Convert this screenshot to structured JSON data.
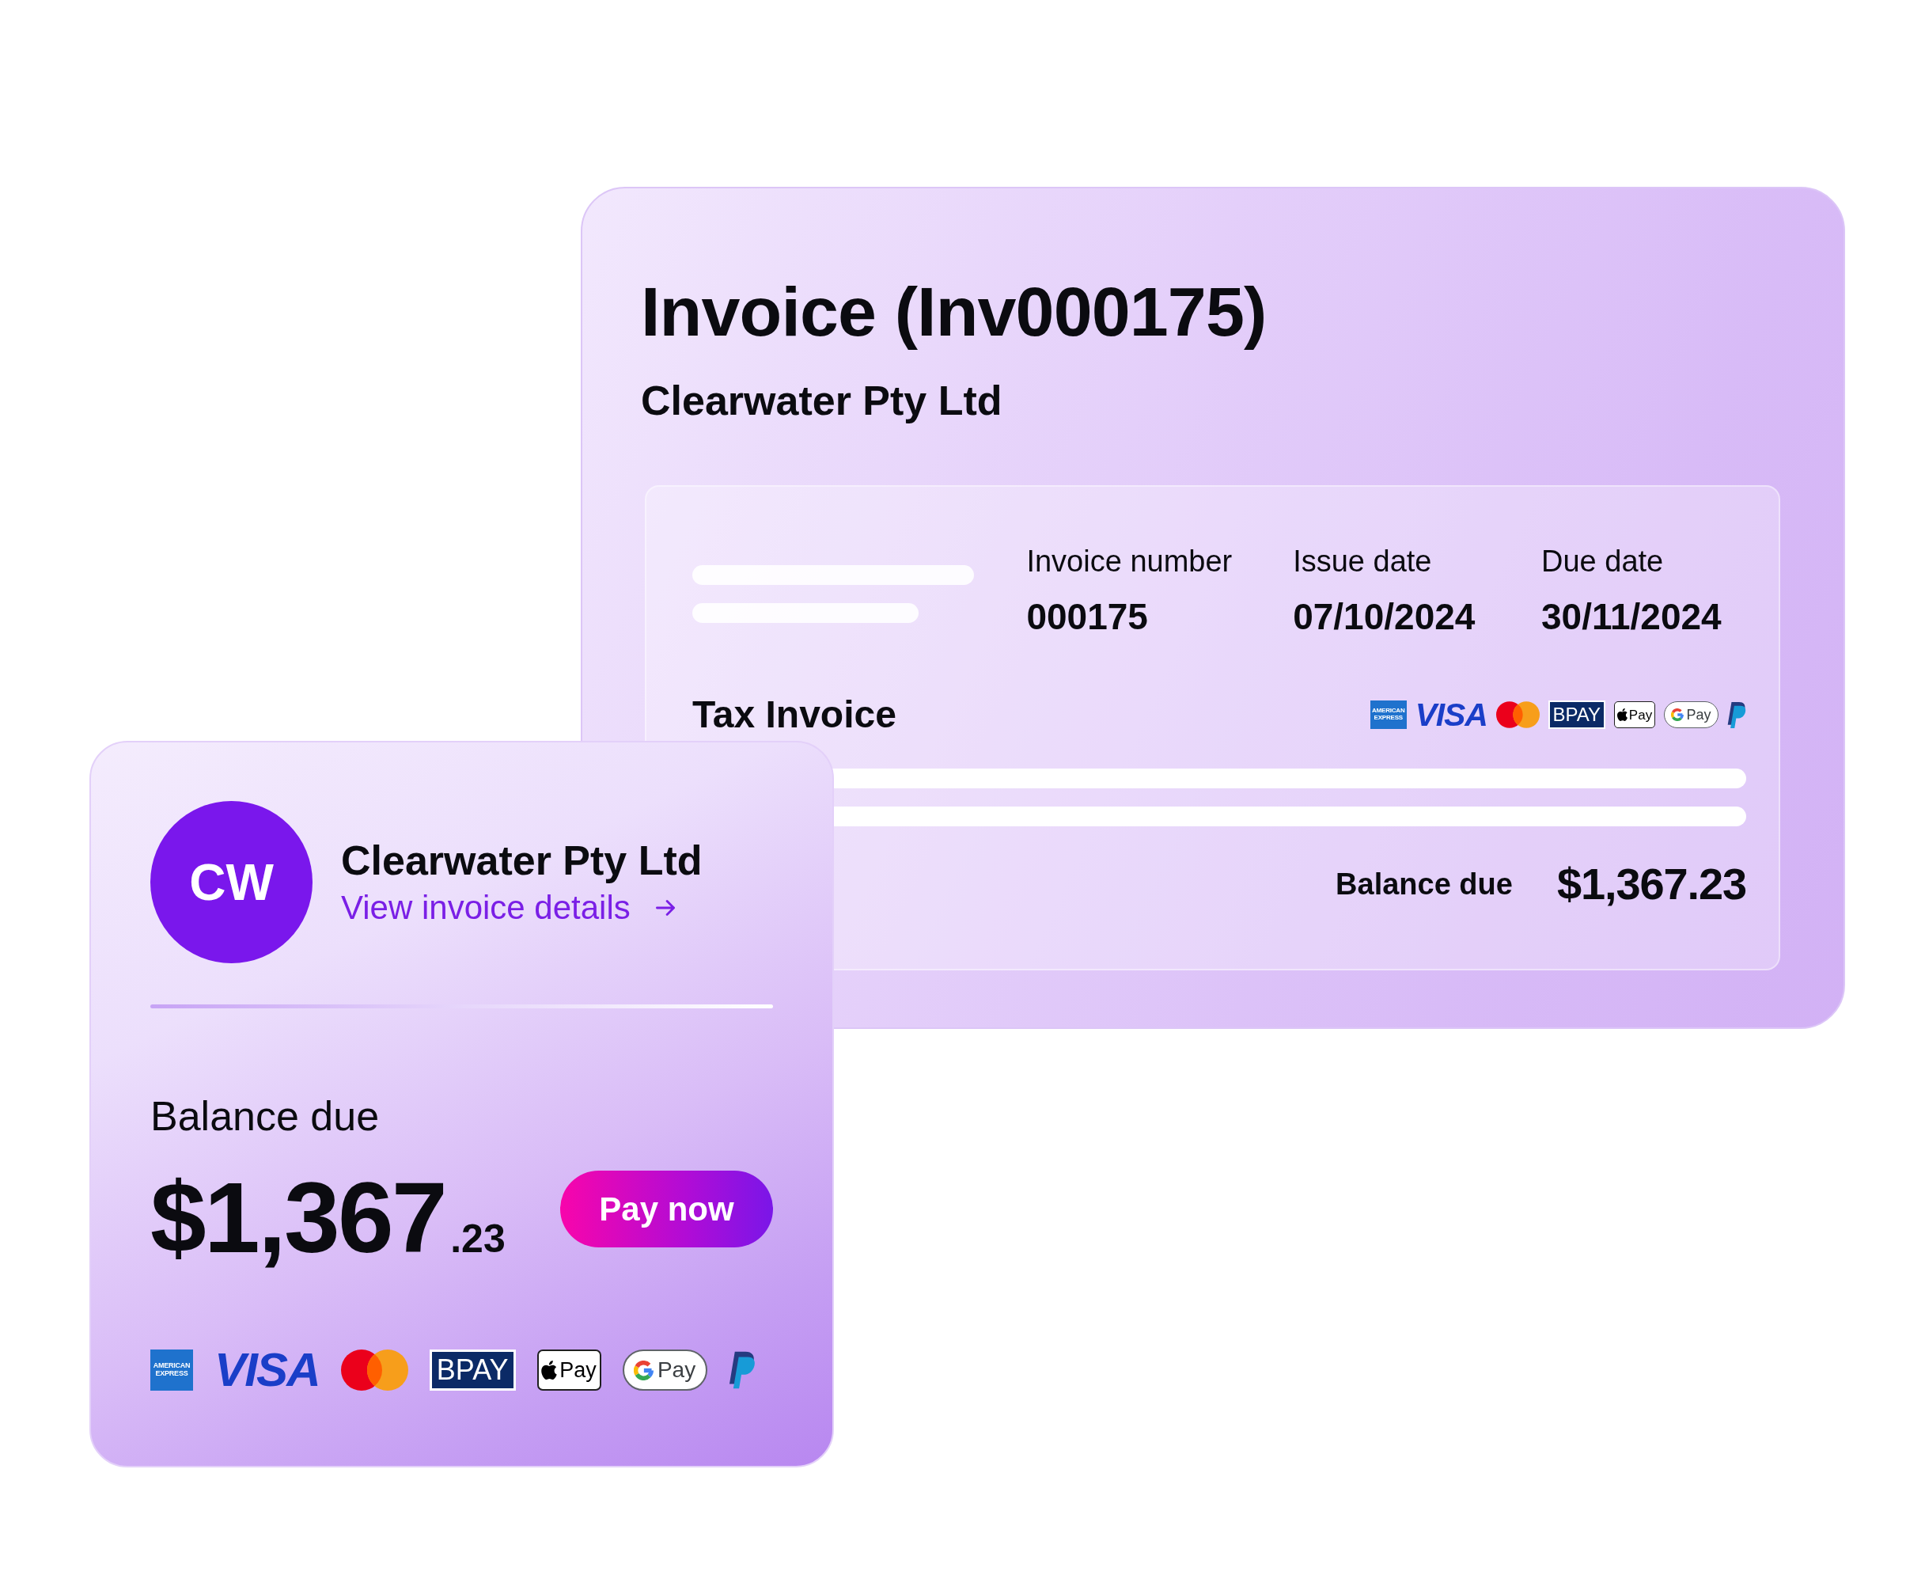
{
  "invoice_card": {
    "title": "Invoice (Inv000175)",
    "company": "Clearwater Pty Ltd",
    "details": {
      "fields": [
        {
          "label": "Invoice number",
          "value": "000175"
        },
        {
          "label": "Issue date",
          "value": "07/10/2024"
        },
        {
          "label": "Due date",
          "value": "30/11/2024"
        }
      ],
      "heading": "Tax Invoice",
      "payment_methods": [
        {
          "kind": "amex",
          "label": "AMERICAN EXPRESS"
        },
        {
          "kind": "visa",
          "label": "VISA"
        },
        {
          "kind": "mastercard"
        },
        {
          "kind": "bpay",
          "label": "BPAY"
        },
        {
          "kind": "applepay",
          "label": "Pay"
        },
        {
          "kind": "googlepay",
          "label": "Pay"
        },
        {
          "kind": "paypal"
        }
      ],
      "balance": {
        "label": "Balance due",
        "amount": "$1,367.23"
      }
    }
  },
  "payment_card": {
    "avatar": "CW",
    "company": "Clearwater Pty Ltd",
    "link": "View invoice details",
    "balance": {
      "label": "Balance due",
      "amount": "$1,367",
      "cents": ".23"
    },
    "button": "Pay now",
    "payment_methods": [
      {
        "kind": "amex",
        "label": "AMERICAN EXPRESS"
      },
      {
        "kind": "visa",
        "label": "VISA"
      },
      {
        "kind": "mastercard"
      },
      {
        "kind": "bpay",
        "label": "BPAY"
      },
      {
        "kind": "applepay",
        "label": "Pay"
      },
      {
        "kind": "googlepay",
        "label": "Pay"
      },
      {
        "kind": "paypal"
      }
    ]
  }
}
